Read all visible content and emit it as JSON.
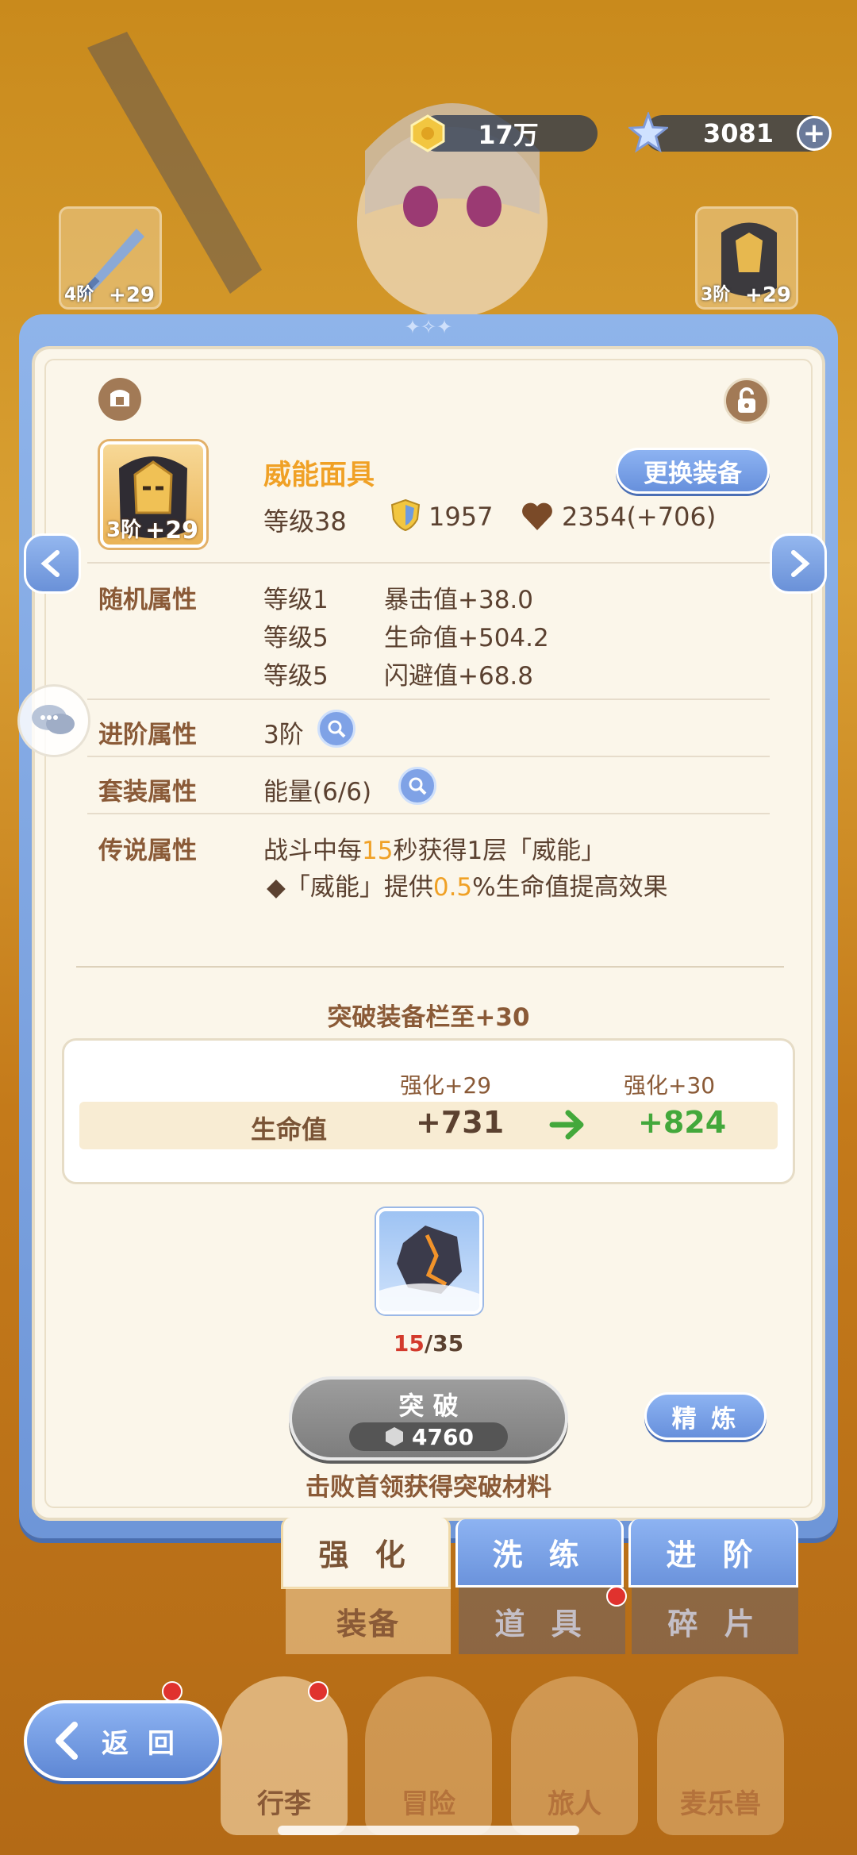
{
  "currency": {
    "coins": "17万",
    "stars": "3081"
  },
  "slots": {
    "left": {
      "tier": "4阶",
      "plus": "+29"
    },
    "right": {
      "tier": "3阶",
      "plus": "+29"
    }
  },
  "item": {
    "tier": "3阶",
    "plus": "+29",
    "name": "威能面具",
    "change_button": "更换装备",
    "level": "等级38",
    "defense": "1957",
    "hp": "2354(+706)"
  },
  "attributes": {
    "random_label": "随机属性",
    "random": [
      {
        "level": "等级1",
        "stat": "暴击值+38.0"
      },
      {
        "level": "等级5",
        "stat": "生命值+504.2"
      },
      {
        "level": "等级5",
        "stat": "闪避值+68.8"
      }
    ],
    "advance_label": "进阶属性",
    "advance_value": "3阶",
    "set_label": "套装属性",
    "set_value": "能量(6/6)",
    "legend_label": "传说属性",
    "legend_line1": {
      "a": "战斗中每",
      "b": "15",
      "c": "秒获得1层「威能」"
    },
    "legend_line2": {
      "a": "◆「威能」提供",
      "b": "0.5",
      "c": "%生命值提高效果"
    }
  },
  "breakthrough": {
    "title": "突破装备栏至+30",
    "col_current": "强化+29",
    "col_next": "强化+30",
    "stat": "生命值",
    "current": "+731",
    "next": "+824",
    "material_have": "15",
    "material_need": "/35",
    "button": "突 破",
    "cost": "4760",
    "refine": "精 炼",
    "hint": "击败首领获得突破材料"
  },
  "tabs": [
    "强 化",
    "洗 练",
    "进 阶"
  ],
  "subtabs": [
    "装备",
    "道 具",
    "碎 片"
  ],
  "back": "返 回",
  "nav": [
    "行李",
    "冒险",
    "旅人",
    "麦乐兽"
  ],
  "colors": {
    "accent_blue": "#6e96d8",
    "orange": "#f0a126",
    "green": "#43a83b",
    "paper": "#fbf6ea"
  }
}
